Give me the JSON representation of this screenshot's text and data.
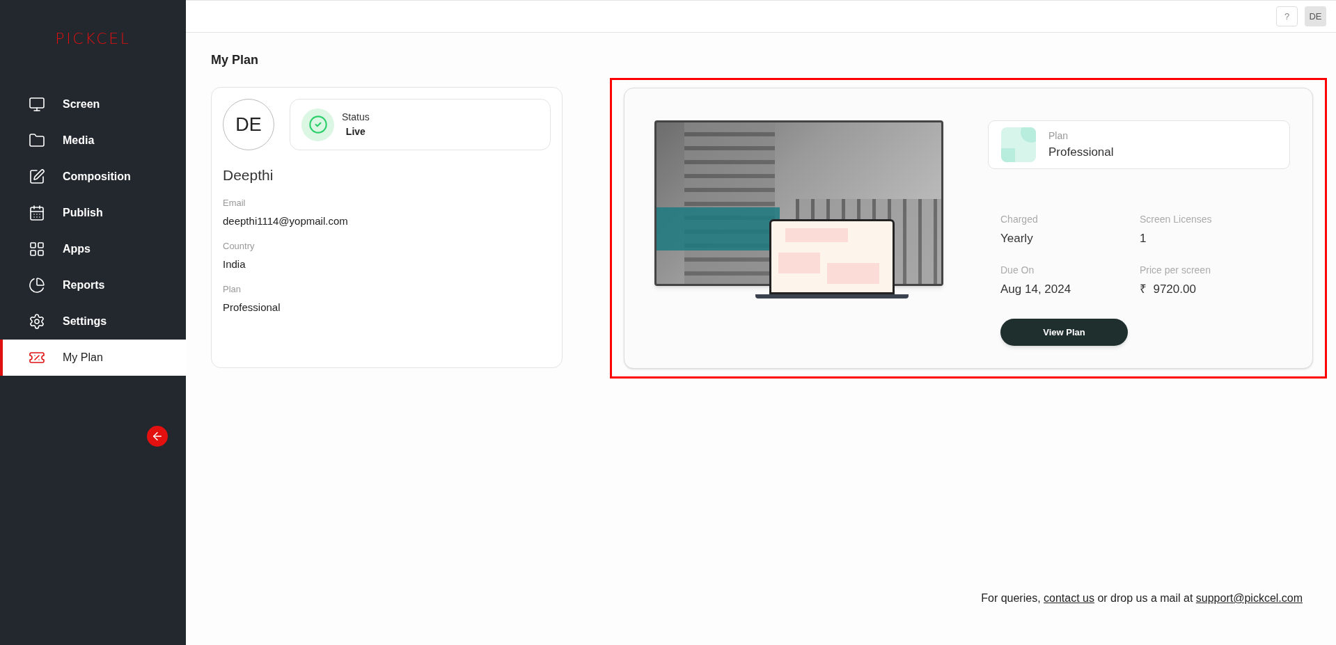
{
  "logo": "PICKCEL",
  "sidebar": {
    "items": [
      {
        "label": "Screen",
        "selected": false
      },
      {
        "label": "Media",
        "selected": false
      },
      {
        "label": "Composition",
        "selected": false
      },
      {
        "label": "Publish",
        "selected": false
      },
      {
        "label": "Apps",
        "selected": false
      },
      {
        "label": "Reports",
        "selected": false
      },
      {
        "label": "Settings",
        "selected": false
      },
      {
        "label": "My Plan",
        "selected": true
      }
    ]
  },
  "topbar": {
    "help": "?",
    "avatar": "DE"
  },
  "page_title": "My Plan",
  "profile": {
    "initials": "DE",
    "status_label": "Status",
    "status": "Live",
    "name": "Deepthi",
    "fields": [
      {
        "label": "Email",
        "value": "deepthi1114@yopmail.com"
      },
      {
        "label": "Country",
        "value": "India"
      },
      {
        "label": "Plan",
        "value": "Professional"
      }
    ]
  },
  "plan_card": {
    "highlighted": true,
    "plan_label": "Plan",
    "plan": "Professional",
    "stats": [
      {
        "label": "Charged",
        "value": "Yearly"
      },
      {
        "label": "Screen Licenses",
        "value": "1"
      },
      {
        "label": "Due On",
        "value": "Aug 14, 2024"
      },
      {
        "label": "Price per screen",
        "value": "₹  9720.00"
      }
    ],
    "button": "View Plan"
  },
  "footer": {
    "before": "For queries, ",
    "link": "contact us",
    "middle": " or drop us a mail at ",
    "email": "support@pickcel.com"
  }
}
